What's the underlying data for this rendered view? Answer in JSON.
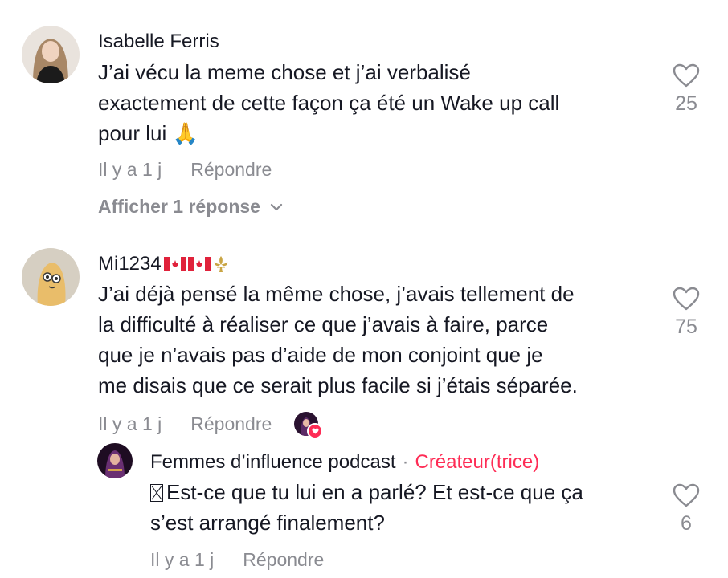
{
  "comments": [
    {
      "username": "Isabelle Ferris",
      "text_lines": [
        "J’ai vécu la meme chose et j’ai verbalisé",
        "exactement de cette façon ça été un Wake up call",
        "pour lui"
      ],
      "emoji": "🙏",
      "time": "Il y a 1 j",
      "reply_label": "Répondre",
      "likes": "25",
      "show_replies": "Afficher 1 réponse"
    },
    {
      "username": "Mi1234",
      "username_suffix_icons": [
        "canada-flag-icon",
        "canada-flag-icon",
        "fleur-de-lis-icon"
      ],
      "text_lines": [
        "J’ai déjà pensé la même chose, j’avais tellement de",
        "la difficulté à réaliser ce que j’avais à faire, parce",
        "que je n’avais pas d’aide de mon conjoint que je",
        "me disais que ce serait plus facile si j’étais séparée."
      ],
      "time": "Il y a 1 j",
      "reply_label": "Répondre",
      "likes": "75",
      "creator_liked": true
    }
  ],
  "reply": {
    "username": "Femmes d’influence podcast",
    "separator": "·",
    "badge": "Créateur(trice)",
    "text_lines": [
      "Est-ce que tu lui en a parlé? Et est-ce que ça",
      "s’est arrangé finalement?"
    ],
    "time": "Il y a 1 j",
    "reply_label": "Répondre",
    "likes": "6"
  },
  "colors": {
    "text": "#161823",
    "muted": "#8a8b91",
    "accent": "#fe2c55"
  },
  "icons": {
    "like": "heart-outline-icon",
    "chevron": "chevron-down-icon"
  }
}
